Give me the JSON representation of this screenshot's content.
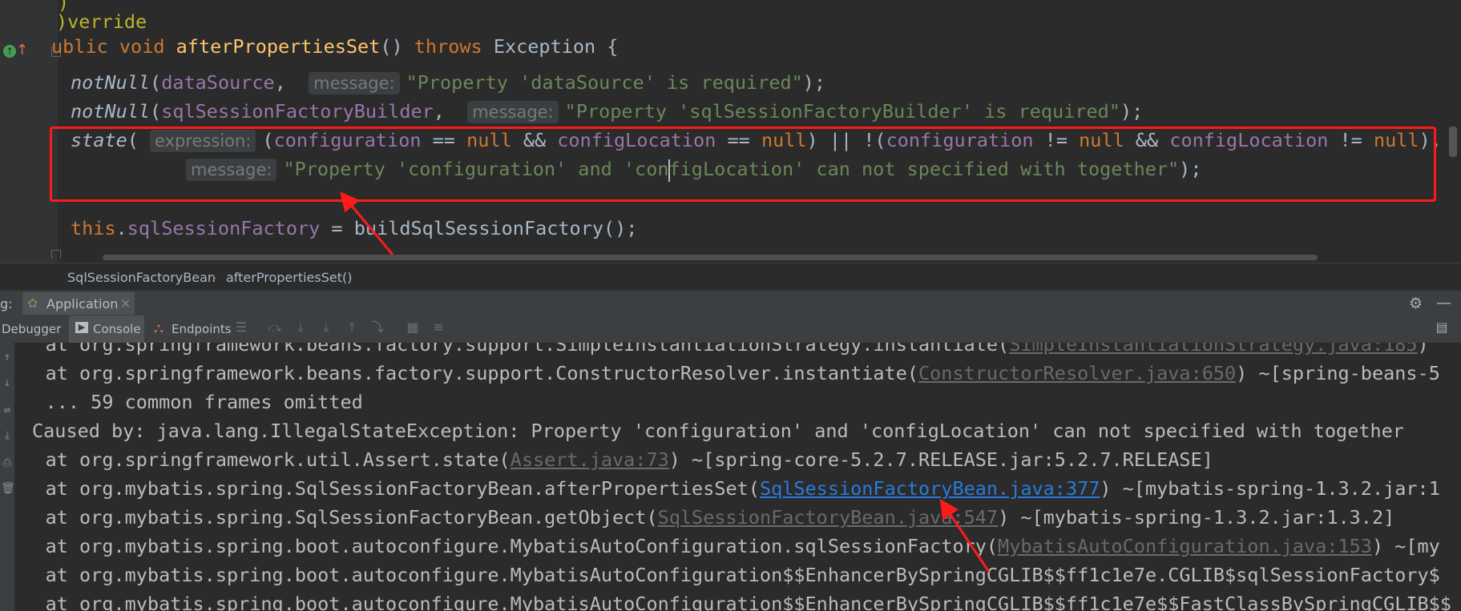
{
  "editor": {
    "lines": {
      "l0": ")",
      "l1_annotation": ")verride",
      "l2_kw1": "ublic",
      "l2_kw2": "void",
      "l2_fn": "afterPropertiesSet",
      "l2_paren": "()",
      "l2_kw3": "throws",
      "l2_rest": "Exception {",
      "l3_fn": "notNull",
      "l3_arg": "dataSource",
      "l3_hint": "message:",
      "l3_str": "\"Property 'dataSource' is required\"",
      "l3_end": ");",
      "l4_fn": "notNull",
      "l4_arg": "sqlSessionFactoryBuilder",
      "l4_hint": "message:",
      "l4_str": "\"Property 'sqlSessionFactoryBuilder' is required\"",
      "l4_end": ");",
      "l5_fn": "state",
      "l5_hint": "expression:",
      "l5_f1": "configuration",
      "l5_op1": " == ",
      "l5_null1": "null",
      "l5_and1": " && ",
      "l5_f2": "configLocation",
      "l5_op2": " == ",
      "l5_null2": "null",
      "l5_or": ") || !(",
      "l5_f3": "configuration",
      "l5_op3": " != ",
      "l5_null3": "null",
      "l5_and2": " && ",
      "l5_f4": "configLocation",
      "l5_op4": " != ",
      "l5_null4": "null",
      "l5_end": "),",
      "l6_hint": "message:",
      "l6_str_a": "\"Property 'configuration' and 'con",
      "l6_str_b": "figLocation' can not specified with together\"",
      "l6_end": ");",
      "l8_this": "this",
      "l8_field": "sqlSessionFactory",
      "l8_rest": " = buildSqlSessionFactory();"
    }
  },
  "breadcrumb": {
    "class_name": "SqlSessionFactoryBean",
    "separator": "›",
    "method_name": "afterPropertiesSet()"
  },
  "run_window": {
    "label": "g:",
    "tab_label": "Application",
    "tab_close": "×",
    "toolbar": {
      "debugger": "Debugger",
      "console": "Console",
      "endpoints": "Endpoints"
    }
  },
  "console": {
    "lines": {
      "c0_pre": "    at org.springframework.beans.factory.support.SimpleInstantiationStrategy.instantiate(",
      "c0_link": "SimpleInstantiationStrategy.java:185",
      "c0_post": ")",
      "c1_pre": "    at org.springframework.beans.factory.support.ConstructorResolver.instantiate(",
      "c1_link": "ConstructorResolver.java:650",
      "c1_post": ") ~[spring-beans-5",
      "c2": "    ... 59 common frames omitted",
      "c3": "Caused by: java.lang.IllegalStateException: Property 'configuration' and 'configLocation' can not specified with together",
      "c4_pre": "    at org.springframework.util.Assert.state(",
      "c4_link": "Assert.java:73",
      "c4_post": ") ~[spring-core-5.2.7.RELEASE.jar:5.2.7.RELEASE]",
      "c5_pre": "    at org.mybatis.spring.SqlSessionFactoryBean.afterPropertiesSet(",
      "c5_link": "SqlSessionFactoryBean.java:377",
      "c5_post": ") ~[mybatis-spring-1.3.2.jar:1",
      "c6_pre": "    at org.mybatis.spring.SqlSessionFactoryBean.getObject(",
      "c6_link": "SqlSessionFactoryBean.java:547",
      "c6_post": ") ~[mybatis-spring-1.3.2.jar:1.3.2]",
      "c7_pre": "    at org.mybatis.spring.boot.autoconfigure.MybatisAutoConfiguration.sqlSessionFactory(",
      "c7_link": "MybatisAutoConfiguration.java:153",
      "c7_post": ") ~[my",
      "c8": "    at org.mybatis.spring.boot.autoconfigure.MybatisAutoConfiguration$$EnhancerBySpringCGLIB$$ff1c1e7e.CGLIB$sqlSessionFactory$",
      "c9": "    at org.mybatis.spring.boot.autoconfigure.MybatisAutoConfiguration$$EnhancerBySpringCGLIB$$ff1c1e7e$$FastClassBySpringCGLIB$$"
    }
  },
  "colors": {
    "highlight": "#ff1a1a",
    "keyword": "#cc7832",
    "string": "#6a8759",
    "field": "#9876aa",
    "function": "#ffc66d",
    "link": "#287bde"
  }
}
